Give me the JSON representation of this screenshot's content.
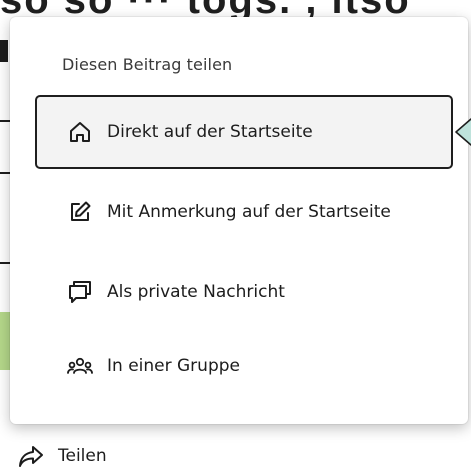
{
  "background": {
    "heading_fragment": "so so ··· togs. , itso"
  },
  "popup": {
    "title": "Diesen Beitrag teilen",
    "items": [
      {
        "label": "Direkt auf der Startseite",
        "icon": "home-icon",
        "selected": true
      },
      {
        "label": "Mit Anmerkung auf der Startseite",
        "icon": "edit-icon",
        "selected": false
      },
      {
        "label": "Als private Nachricht",
        "icon": "message-icon",
        "selected": false
      },
      {
        "label": "In einer Gruppe",
        "icon": "group-icon",
        "selected": false
      }
    ]
  },
  "share": {
    "label": "Teilen",
    "icon": "share-arrow-icon"
  },
  "colors": {
    "selected_border": "#1e1e1e",
    "selected_bg": "#f3f3f3",
    "pointer_fill": "#bfe3dc",
    "accent_green": "#b5d88a"
  }
}
